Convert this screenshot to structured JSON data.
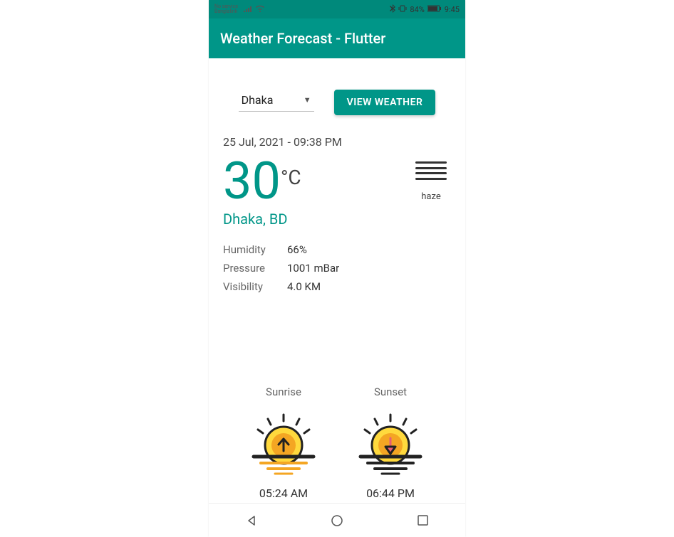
{
  "status_bar": {
    "carrier": "No service",
    "carrier2": "Banglalink",
    "bluetooth_icon": "bluetooth",
    "battery_pct": "84%",
    "time": "9:45"
  },
  "app_bar": {
    "title": "Weather Forecast - Flutter"
  },
  "controls": {
    "dropdown_selected": "Dhaka",
    "view_button_label": "VIEW WEATHER"
  },
  "datetime": "25 Jul, 2021 - 09:38 PM",
  "temperature": {
    "value": "30",
    "unit": "°C"
  },
  "condition": {
    "icon_name": "haze",
    "label": "haze"
  },
  "location": "Dhaka, BD",
  "stats": {
    "humidity_label": "Humidity",
    "humidity_value": "66%",
    "pressure_label": "Pressure",
    "pressure_value": "1001 mBar",
    "visibility_label": "Visibility",
    "visibility_value": "4.0 KM"
  },
  "sun": {
    "sunrise_label": "Sunrise",
    "sunrise_time": "05:24 AM",
    "sunset_label": "Sunset",
    "sunset_time": "06:44 PM"
  }
}
